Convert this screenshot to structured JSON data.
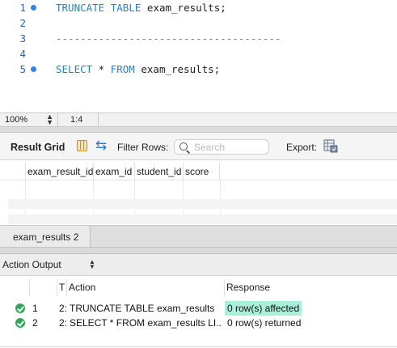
{
  "editor": {
    "lines": [
      {
        "number": "1",
        "has_marker": true,
        "keyword1": "TRUNCATE",
        "keyword2": "TABLE",
        "rest": " exam_results;"
      },
      {
        "number": "2",
        "has_marker": false
      },
      {
        "number": "3",
        "has_marker": false,
        "text": "-------------------------------------"
      },
      {
        "number": "4",
        "has_marker": false
      },
      {
        "number": "5",
        "has_marker": true,
        "keyword1": "SELECT",
        "mid": " * ",
        "keyword2": "FROM",
        "rest": " exam_results;"
      }
    ],
    "keyword_color": "#1a86c8",
    "line_number_color": "#2d64b4"
  },
  "status_bar": {
    "zoom": "100%",
    "cursor_position": "1:4"
  },
  "result_toolbar": {
    "title": "Result Grid",
    "filter_label": "Filter Rows:",
    "search_placeholder": "Search",
    "export_label": "Export:"
  },
  "result_grid": {
    "columns": [
      "exam_result_id",
      "exam_id",
      "student_id",
      "score"
    ]
  },
  "result_tabs": [
    {
      "label": "exam_results 2",
      "active": true
    }
  ],
  "action_output": {
    "selector_label": "Action Output",
    "columns": [
      "T",
      "Action",
      "Response"
    ],
    "rows": [
      {
        "status": "success",
        "index": "1",
        "time": "2:",
        "action": "TRUNCATE TABLE exam_results",
        "response": "0 row(s) affected",
        "highlighted": true
      },
      {
        "status": "success",
        "index": "2",
        "time": "2:",
        "action": "SELECT * FROM exam_results LI...",
        "response": "0 row(s) returned",
        "highlighted": false
      }
    ],
    "highlight_color": "#a9f0da",
    "success_color": "#33a65a"
  }
}
